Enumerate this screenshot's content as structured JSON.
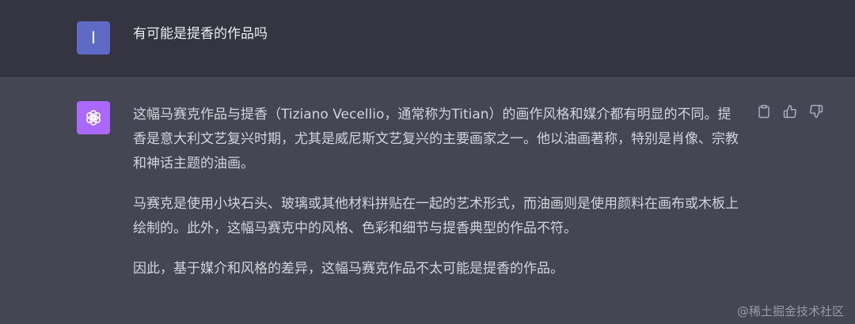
{
  "user": {
    "avatar_letter": "I",
    "message": "有可能是提香的作品吗"
  },
  "assistant": {
    "avatar_icon": "openai-logo-icon",
    "paragraphs": [
      "这幅马赛克作品与提香（Tiziano Vecellio，通常称为Titian）的画作风格和媒介都有明显的不同。提香是意大利文艺复兴时期，尤其是威尼斯文艺复兴的主要画家之一。他以油画著称，特别是肖像、宗教和神话主题的油画。",
      "马赛克是使用小块石头、玻璃或其他材料拼贴在一起的艺术形式，而油画则是使用颜料在画布或木板上绘制的。此外，这幅马赛克中的风格、色彩和细节与提香典型的作品不符。",
      "因此，基于媒介和风格的差异，这幅马赛克作品不太可能是提香的作品。"
    ],
    "actions": [
      "copy-icon",
      "thumbs-up-icon",
      "thumbs-down-icon"
    ]
  },
  "watermark": "@稀土掘金技术社区",
  "colors": {
    "user_bg": "#343541",
    "assistant_bg": "#444654",
    "user_avatar": "#5e6ac4",
    "bot_avatar": "#ab68ff",
    "text": "#d1d5db"
  }
}
